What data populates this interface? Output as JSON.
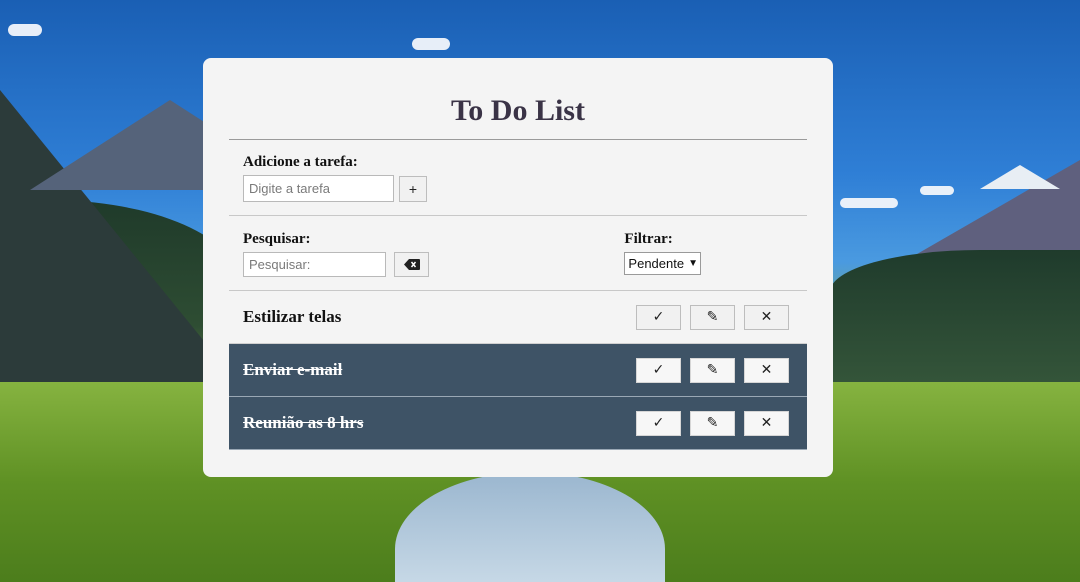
{
  "app": {
    "title": "To Do List"
  },
  "add_task": {
    "label": "Adicione a tarefa:",
    "placeholder": "Digite a tarefa",
    "add_button_label": "+"
  },
  "search": {
    "label": "Pesquisar:",
    "placeholder": "Pesquisar:"
  },
  "filter": {
    "label": "Filtrar:",
    "selected": "Pendente"
  },
  "todos": [
    {
      "text": "Estilizar telas",
      "done": false
    },
    {
      "text": "Enviar e-mail",
      "done": true
    },
    {
      "text": "Reunião as 8 hrs",
      "done": true
    }
  ],
  "icons": {
    "check": "check-icon",
    "edit": "pencil-icon",
    "delete": "close-icon",
    "erase": "backspace-icon"
  },
  "colors": {
    "card_bg": "#f4f4f4",
    "done_row_bg": "#3e5366",
    "title_color": "#3a3346"
  }
}
